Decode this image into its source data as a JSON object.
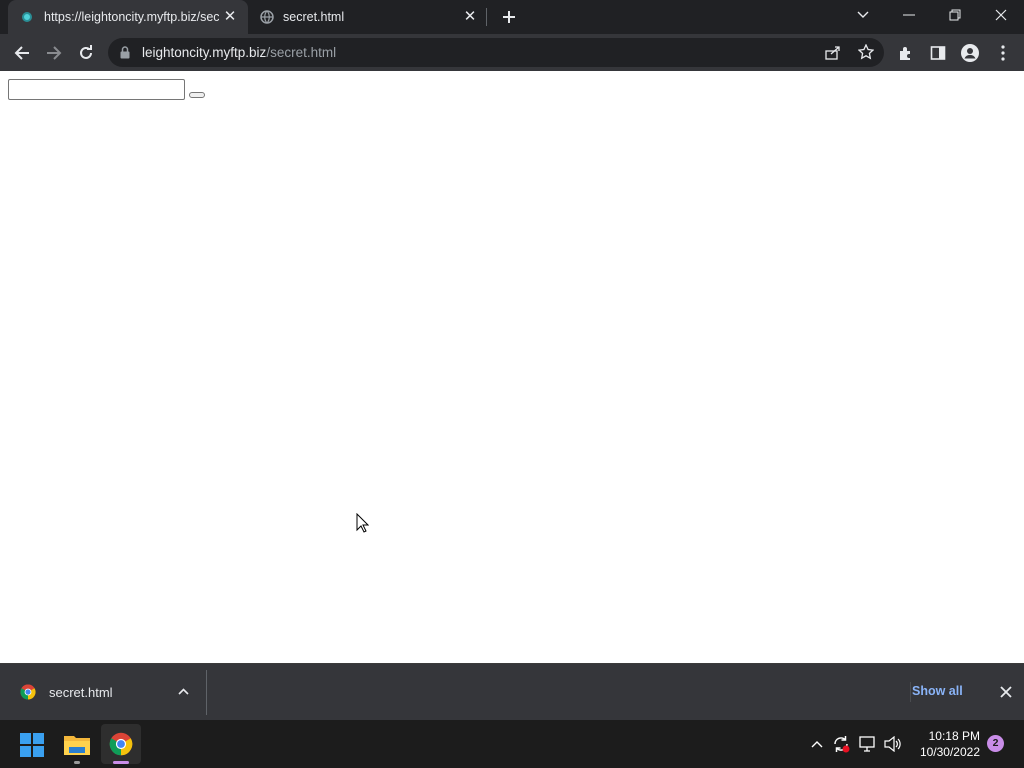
{
  "browser": {
    "tabs": [
      {
        "title": "https://leightoncity.myftp.biz/secret.html",
        "active": true
      },
      {
        "title": "secret.html",
        "active": false
      }
    ],
    "address": {
      "host": "leightoncity.myftp.biz",
      "path": "/secret.html"
    }
  },
  "downloads": {
    "items": [
      {
        "filename": "secret.html"
      }
    ],
    "show_all_label": "Show all"
  },
  "taskbar": {
    "time": "10:18 PM",
    "date": "10/30/2022",
    "notification_count": "2"
  },
  "colors": {
    "chrome_dark": "#202124",
    "chrome_toolbar": "#35363a",
    "link_blue": "#8ab4f8",
    "taskbar": "#1c1c1c"
  }
}
